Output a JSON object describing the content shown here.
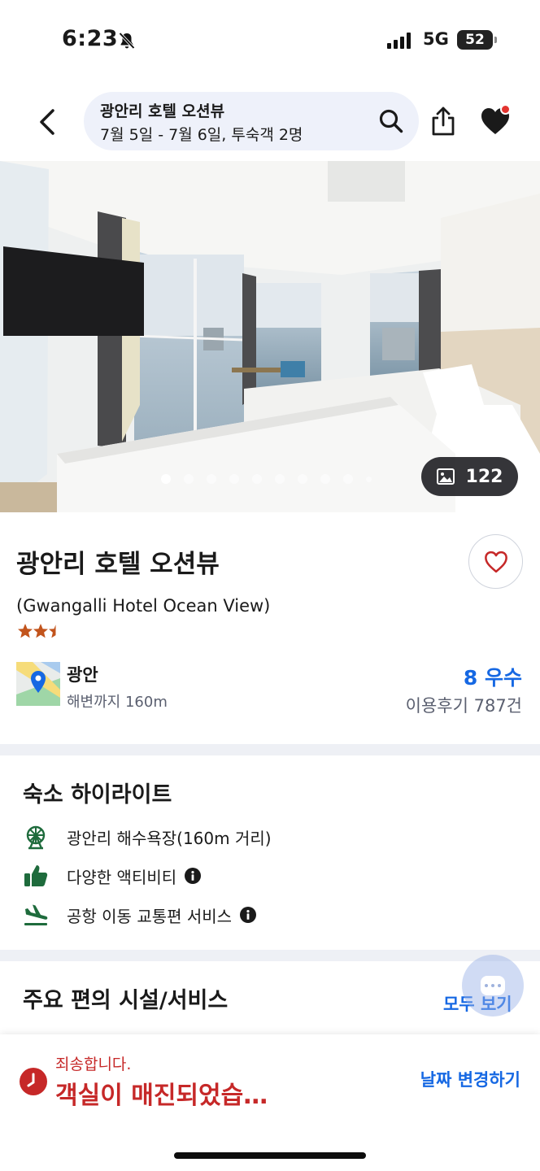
{
  "status_bar": {
    "time": "6:23",
    "network": "5G",
    "battery": "52"
  },
  "header": {
    "search_title": "광안리 호텔 오션뷰",
    "search_subtitle": "7월 5일 - 7월 6일, 투숙객 2명"
  },
  "gallery": {
    "photo_count": "122",
    "total_dots": 10,
    "active_dot": 0
  },
  "hotel": {
    "name": "광안리 호텔 오션뷰",
    "english_name": "(Gwangalli Hotel Ocean View)",
    "star_rating": 2.5,
    "area": "광안",
    "beach_distance": "해변까지 160m",
    "rating": "8 우수",
    "reviews": "이용후기 787건"
  },
  "highlights": {
    "title": "숙소 하이라이트",
    "items": [
      {
        "icon": "ferris-wheel-icon",
        "label": "광안리 해수욕장(160m 거리)",
        "info": false
      },
      {
        "icon": "thumbs-up-icon",
        "label": "다양한 액티비티",
        "info": true
      },
      {
        "icon": "airplane-icon",
        "label": "공항 이동 교통편 서비스",
        "info": true
      }
    ]
  },
  "amenities": {
    "title": "주요 편의 시설/서비스",
    "see_all": "모두 보기"
  },
  "bottom_bar": {
    "sorry": "죄송합니다.",
    "sold_out": "객실이 매진되었습…",
    "change_date": "날짜 변경하기"
  },
  "colors": {
    "accent": "#1668e3",
    "alert": "#c62828",
    "highlight_icon": "#1e6b3c",
    "star": "#c2541c"
  }
}
